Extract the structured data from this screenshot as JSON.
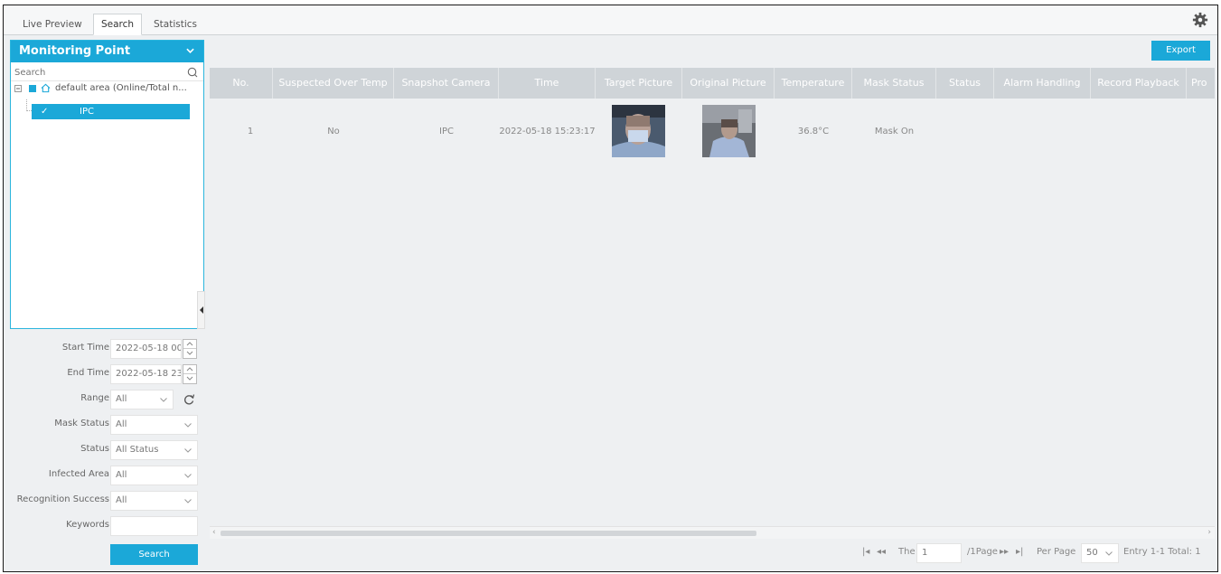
{
  "tabs": [
    {
      "label": "Live Preview",
      "active": false
    },
    {
      "label": "Search",
      "active": true
    },
    {
      "label": "Statistics",
      "active": false
    }
  ],
  "sidebar": {
    "title": "Monitoring Point",
    "search_placeholder": "Search",
    "tree_root": "default area (Online/Total n...",
    "tree_child": "IPC"
  },
  "filters": {
    "start_time_label": "Start Time",
    "start_time_value": "2022-05-18 00",
    "end_time_label": "End Time",
    "end_time_value": "2022-05-18 23",
    "range_label": "Range",
    "range_value": "All",
    "mask_status_label": "Mask Status",
    "mask_status_value": "All",
    "status_label": "Status",
    "status_value": "All Status",
    "infected_area_label": "Infected Area",
    "infected_area_value": "All",
    "recognition_label": "Recognition Success",
    "recognition_value": "All",
    "keywords_label": "Keywords",
    "keywords_value": "",
    "search_button": "Search"
  },
  "toolbar": {
    "export_label": "Export"
  },
  "table": {
    "columns": [
      "No.",
      "Suspected Over Temp",
      "Snapshot Camera",
      "Time",
      "Target Picture",
      "Original Picture",
      "Temperature",
      "Mask Status",
      "Status",
      "Alarm Handling",
      "Record Playback",
      "Pro"
    ],
    "rows": [
      {
        "no": "1",
        "over_temp": "No",
        "camera": "IPC",
        "time": "2022-05-18 15:23:17",
        "temperature": "36.8°C",
        "mask_status": "Mask On",
        "status": "",
        "alarm": "",
        "playback": ""
      }
    ]
  },
  "pager": {
    "first": "|◂",
    "prev": "◂◂",
    "the_label": "The",
    "page_value": "1",
    "of_pages": "/1Page",
    "next": "▸▸",
    "last": "▸|",
    "per_page_label": "Per Page",
    "per_page_value": "50",
    "entry_info": "Entry  1-1 Total: 1"
  },
  "colors": {
    "accent": "#1ba8d8",
    "header": "#cfd4d8",
    "background": "#eef0f2"
  }
}
